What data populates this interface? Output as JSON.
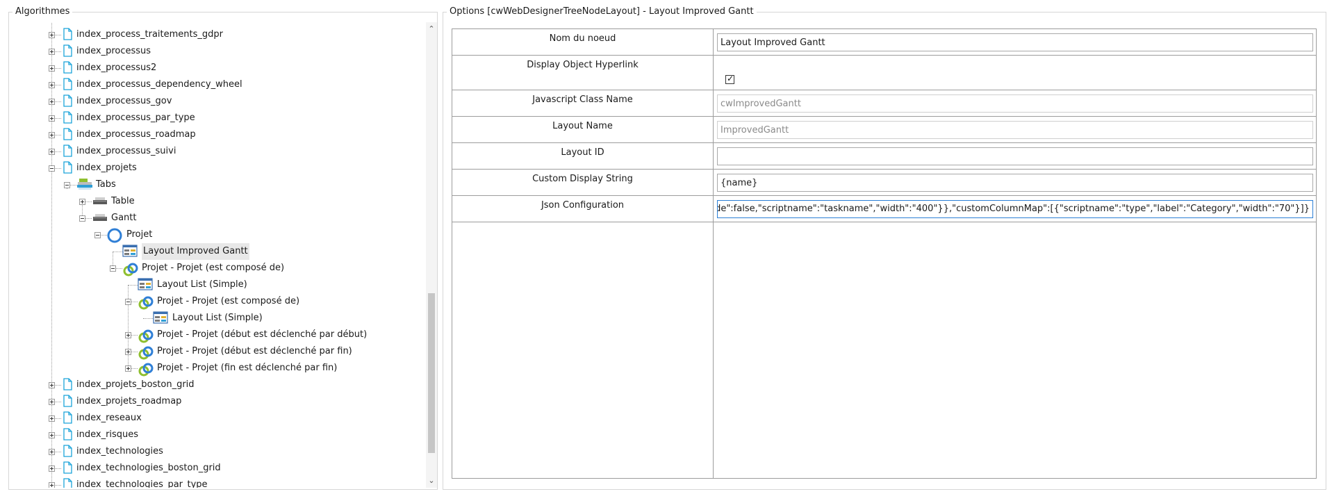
{
  "left_panel": {
    "title": "Algorithmes",
    "tree": [
      {
        "label": "index_process_traitements_gdpr",
        "icon": "page-icon",
        "expander": "plus"
      },
      {
        "label": "index_processus",
        "icon": "page-icon",
        "expander": "plus"
      },
      {
        "label": "index_processus2",
        "icon": "page-icon",
        "expander": "plus"
      },
      {
        "label": "index_processus_dependency_wheel",
        "icon": "page-icon",
        "expander": "plus"
      },
      {
        "label": "index_processus_gov",
        "icon": "page-icon",
        "expander": "plus"
      },
      {
        "label": "index_processus_par_type",
        "icon": "page-icon",
        "expander": "plus"
      },
      {
        "label": "index_processus_roadmap",
        "icon": "page-icon",
        "expander": "plus"
      },
      {
        "label": "index_processus_suivi",
        "icon": "page-icon",
        "expander": "plus"
      },
      {
        "label": "index_projets",
        "icon": "page-icon",
        "expander": "minus"
      },
      {
        "label": "Tabs",
        "icon": "tabs-icon",
        "expander": "minus"
      },
      {
        "label": "Table",
        "icon": "tab-icon",
        "expander": "plus"
      },
      {
        "label": "Gantt",
        "icon": "tab-icon",
        "expander": "minus"
      },
      {
        "label": "Projet",
        "icon": "object-icon",
        "expander": "minus"
      },
      {
        "label": "Layout Improved Gantt",
        "icon": "layout-icon",
        "expander": "none",
        "selected": true
      },
      {
        "label": "Projet - Projet (est composé de)",
        "icon": "association-icon",
        "expander": "minus"
      },
      {
        "label": "Layout List (Simple)",
        "icon": "layout-icon",
        "expander": "none"
      },
      {
        "label": "Projet - Projet (est composé de)",
        "icon": "association-icon",
        "expander": "minus"
      },
      {
        "label": "Layout List (Simple)",
        "icon": "layout-icon",
        "expander": "none"
      },
      {
        "label": "Projet - Projet (début est déclenché par début)",
        "icon": "association-icon",
        "expander": "plus"
      },
      {
        "label": "Projet - Projet (début est déclenché par fin)",
        "icon": "association-icon",
        "expander": "plus"
      },
      {
        "label": "Projet - Projet (fin est déclenché par fin)",
        "icon": "association-icon",
        "expander": "plus"
      },
      {
        "label": "index_projets_boston_grid",
        "icon": "page-icon",
        "expander": "plus"
      },
      {
        "label": "index_projets_roadmap",
        "icon": "page-icon",
        "expander": "plus"
      },
      {
        "label": "index_reseaux",
        "icon": "page-icon",
        "expander": "plus"
      },
      {
        "label": "index_risques",
        "icon": "page-icon",
        "expander": "plus"
      },
      {
        "label": "index_technologies",
        "icon": "page-icon",
        "expander": "plus"
      },
      {
        "label": "index_technologies_boston_grid",
        "icon": "page-icon",
        "expander": "plus"
      },
      {
        "label": "index_technologies_par_type",
        "icon": "page-icon",
        "expander": "plus"
      }
    ]
  },
  "right_panel": {
    "title": "Options [cwWebDesignerTreeNodeLayout] - Layout Improved Gantt",
    "properties": [
      {
        "label": "Nom du noeud",
        "type": "text",
        "value": "Layout Improved Gantt"
      },
      {
        "label": "Display Object Hyperlink",
        "type": "checkbox",
        "checked": true
      },
      {
        "label": "Javascript Class Name",
        "type": "readonly",
        "value": "cwImprovedGantt"
      },
      {
        "label": "Layout Name",
        "type": "readonly",
        "value": "ImprovedGantt"
      },
      {
        "label": "Layout ID",
        "type": "text",
        "value": ""
      },
      {
        "label": "Custom Display String",
        "type": "text",
        "value": "{name}"
      },
      {
        "label": "Json Configuration",
        "type": "focused",
        "value": "skname\":{\"hide\":false,\"scriptname\":\"taskname\",\"width\":\"400\"}},\"customColumnMap\":[{\"scriptname\":\"type\",\"label\":\"Category\",\"width\":\"70\"}]}"
      }
    ]
  },
  "colors": {
    "page_icon": "#1aa3d9",
    "association_ring": "#2f7fd6",
    "association_ring2": "#8fbf2f",
    "selection": "#e8e8e8",
    "focus_border": "#2b7fd6"
  }
}
